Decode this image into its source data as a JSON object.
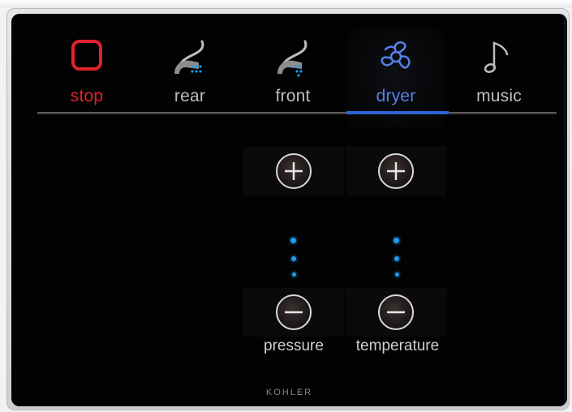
{
  "tabs": [
    {
      "label": "stop",
      "icon": "stop-icon"
    },
    {
      "label": "rear",
      "icon": "rear-wash-icon"
    },
    {
      "label": "front",
      "icon": "front-wash-icon"
    },
    {
      "label": "dryer",
      "icon": "dryer-fan-icon"
    },
    {
      "label": "music",
      "icon": "music-note-icon"
    }
  ],
  "active_tab": "dryer",
  "controls": {
    "pressure": {
      "label": "pressure",
      "increase_icon": "plus-icon",
      "decrease_icon": "minus-icon"
    },
    "temperature": {
      "label": "temperature",
      "increase_icon": "plus-icon",
      "decrease_icon": "minus-icon"
    }
  },
  "brand": "KOHLER",
  "colors": {
    "stop_red": "#e2222a",
    "active_blue": "#5580e8",
    "indicator_blue": "#1e9be8",
    "screen_bg": "#020202"
  }
}
